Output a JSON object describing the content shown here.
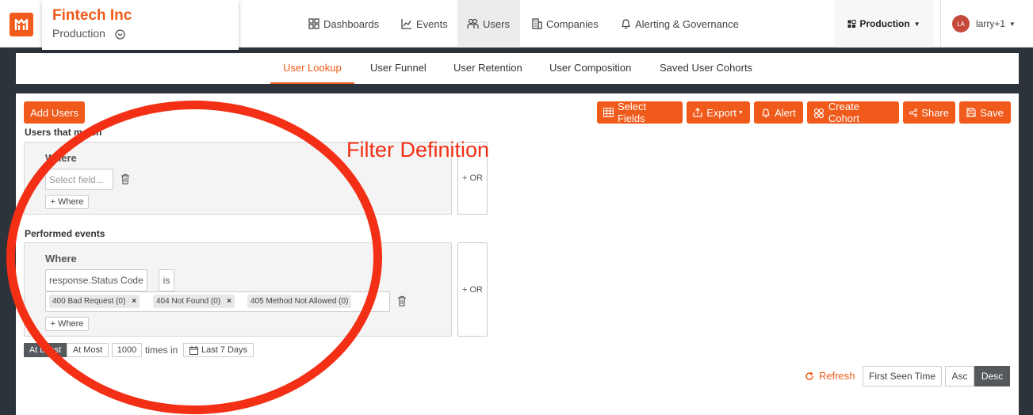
{
  "brand": {
    "name": "Fintech Inc",
    "environment": "Production"
  },
  "nav": {
    "items": [
      {
        "label": "Dashboards",
        "icon": "dashboard-icon"
      },
      {
        "label": "Events",
        "icon": "chart-icon"
      },
      {
        "label": "Users",
        "icon": "users-icon",
        "active": true
      },
      {
        "label": "Companies",
        "icon": "building-icon"
      },
      {
        "label": "Alerting & Governance",
        "icon": "bell-icon"
      }
    ],
    "environment_dropdown": "Production",
    "user": {
      "initials": "LA",
      "name": "larry+1"
    }
  },
  "subtabs": [
    {
      "label": "User Lookup",
      "active": true
    },
    {
      "label": "User Funnel"
    },
    {
      "label": "User Retention"
    },
    {
      "label": "User Composition"
    },
    {
      "label": "Saved User Cohorts"
    }
  ],
  "toolbar": {
    "add_users": "Add Users",
    "select_fields": "Select Fields",
    "export": "Export",
    "alert": "Alert",
    "create_cohort": "Create Cohort",
    "share": "Share",
    "save": "Save"
  },
  "users_match": {
    "label": "Users that match",
    "where_title": "Where",
    "field_placeholder": "Select field...",
    "add_where": "+ Where",
    "or": "+ OR"
  },
  "performed_events": {
    "label": "Performed events",
    "where_title": "Where",
    "field": "response.Status Code",
    "operator": "is",
    "values": [
      "400 Bad Request (0)",
      "404 Not Found (0)",
      "405 Method Not Allowed (0)"
    ],
    "add_where": "+ Where",
    "or": "+ OR"
  },
  "frequency": {
    "at_least": "At Least",
    "at_most": "At Most",
    "count": "1000",
    "times_in": "times in",
    "range": "Last 7 Days"
  },
  "sort": {
    "refresh": "Refresh",
    "field": "First Seen Time",
    "asc": "Asc",
    "desc": "Desc"
  },
  "annotation": {
    "text": "Filter Definition",
    "color": "#f32f15"
  },
  "colors": {
    "accent": "#f05a1a",
    "background": "#2c333b"
  }
}
